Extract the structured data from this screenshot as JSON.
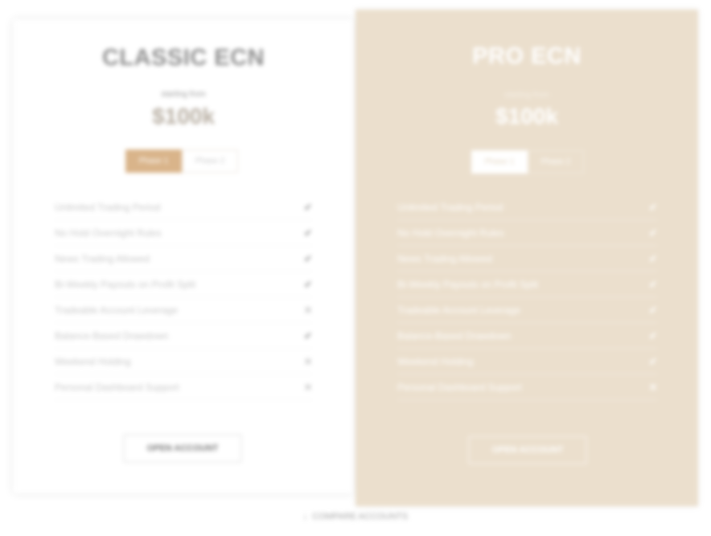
{
  "classic": {
    "title": "CLASSIC ECN",
    "from_label": "starting from",
    "price": "$100k",
    "toggle": [
      "Phase 1",
      "Phase 2"
    ],
    "features": [
      {
        "label": "Unlimited Trading Period",
        "included": true
      },
      {
        "label": "No Hold Overnight Rules",
        "included": true
      },
      {
        "label": "News Trading Allowed",
        "included": true
      },
      {
        "label": "Bi-Weekly Payouts on Profit Split",
        "included": true
      },
      {
        "label": "Tradeable Account Leverage",
        "included": false
      },
      {
        "label": "Balance-Based Drawdown",
        "included": true
      },
      {
        "label": "Weekend Holding",
        "included": false
      },
      {
        "label": "Personal Dashboard Support",
        "included": false
      }
    ],
    "cta": "OPEN ACCOUNT"
  },
  "pro": {
    "title": "PRO ECN",
    "from_label": "starting from",
    "price": "$100k",
    "toggle": [
      "Phase 1",
      "Phase 2"
    ],
    "features": [
      {
        "label": "Unlimited Trading Period",
        "included": true
      },
      {
        "label": "No Hold Overnight Rules",
        "included": true
      },
      {
        "label": "News Trading Allowed",
        "included": true
      },
      {
        "label": "Bi-Weekly Payouts on Profit Split",
        "included": true
      },
      {
        "label": "Tradeable Account Leverage",
        "included": true
      },
      {
        "label": "Balance-Based Drawdown",
        "included": true
      },
      {
        "label": "Weekend Holding",
        "included": true
      },
      {
        "label": "Personal Dashboard Support",
        "included": false
      }
    ],
    "cta": "OPEN ACCOUNT"
  },
  "compare": {
    "arrow": "↓",
    "label": "COMPARE ACCOUNTS"
  },
  "colors": {
    "accent": "#d9b48a",
    "pro_bg": "#ebdfcd"
  }
}
